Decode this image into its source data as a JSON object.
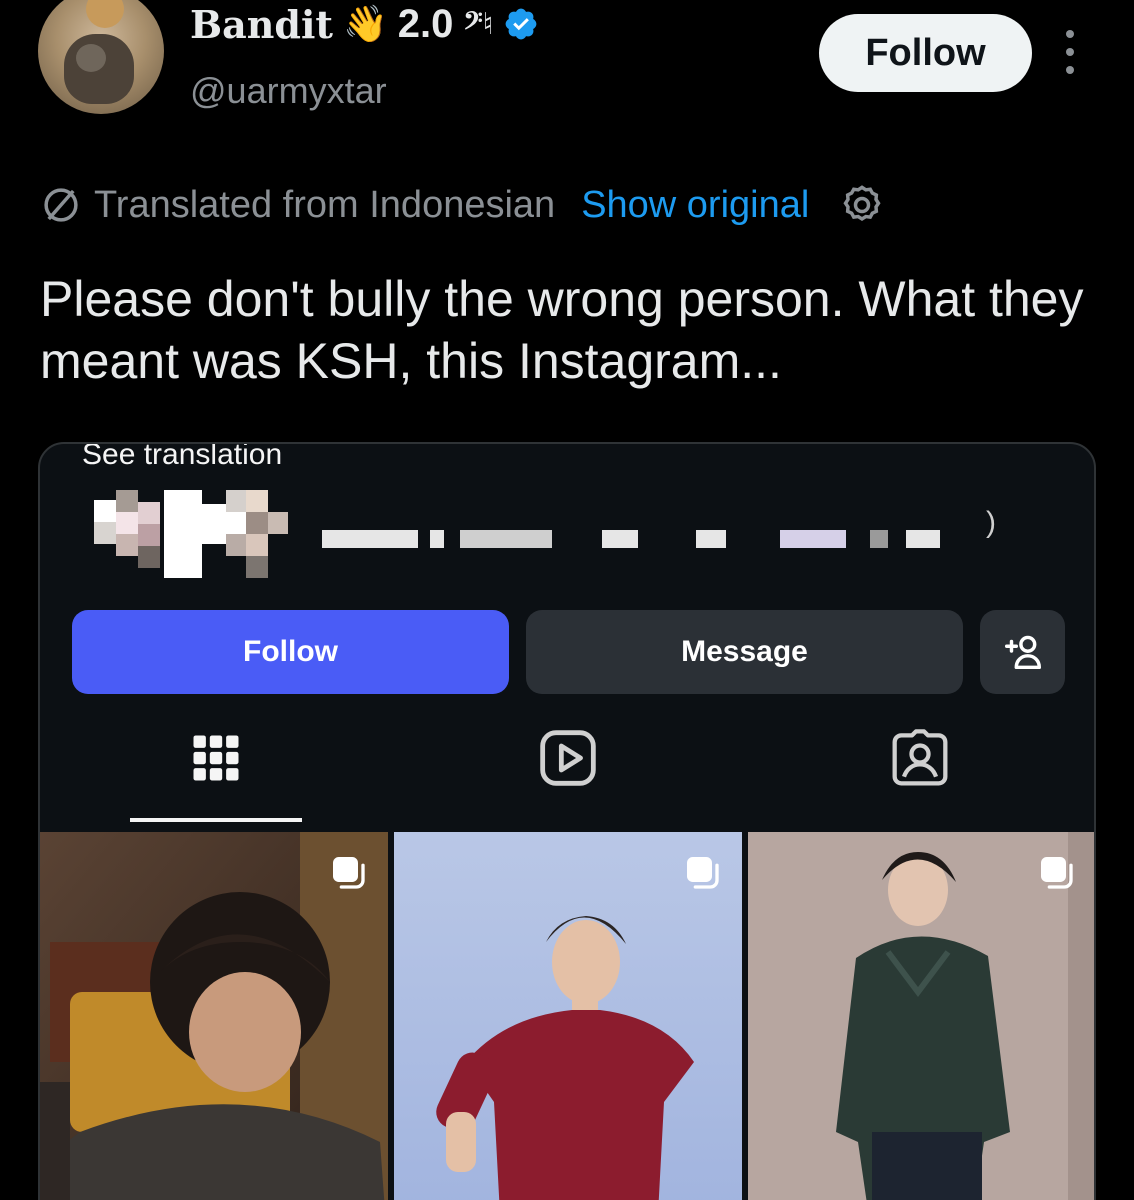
{
  "tweet": {
    "display_name": "Bandit",
    "name_emoji": "👋",
    "name_suffix": "2.0",
    "name_glyphs": "𝄢♮",
    "handle": "@uarmyxtar",
    "follow_label": "Follow",
    "translated_label": "Translated from Indonesian",
    "show_original_label": "Show original",
    "text": "Please don't bully the wrong person. What they meant was KSH, this Instagram..."
  },
  "embedded_instagram": {
    "see_translation": "See translation",
    "follow_label": "Follow",
    "message_label": "Message",
    "paren": ")"
  },
  "colors": {
    "background": "#000000",
    "link": "#1d9bf0",
    "ig_follow": "#4a5cf6",
    "verified": "#1d9bf0"
  },
  "icons": [
    "verified-badge-icon",
    "globe-slash-icon",
    "gear-icon",
    "more-options-icon",
    "add-user-icon",
    "grid-icon",
    "reels-icon",
    "tagged-icon",
    "multi-photo-icon"
  ]
}
